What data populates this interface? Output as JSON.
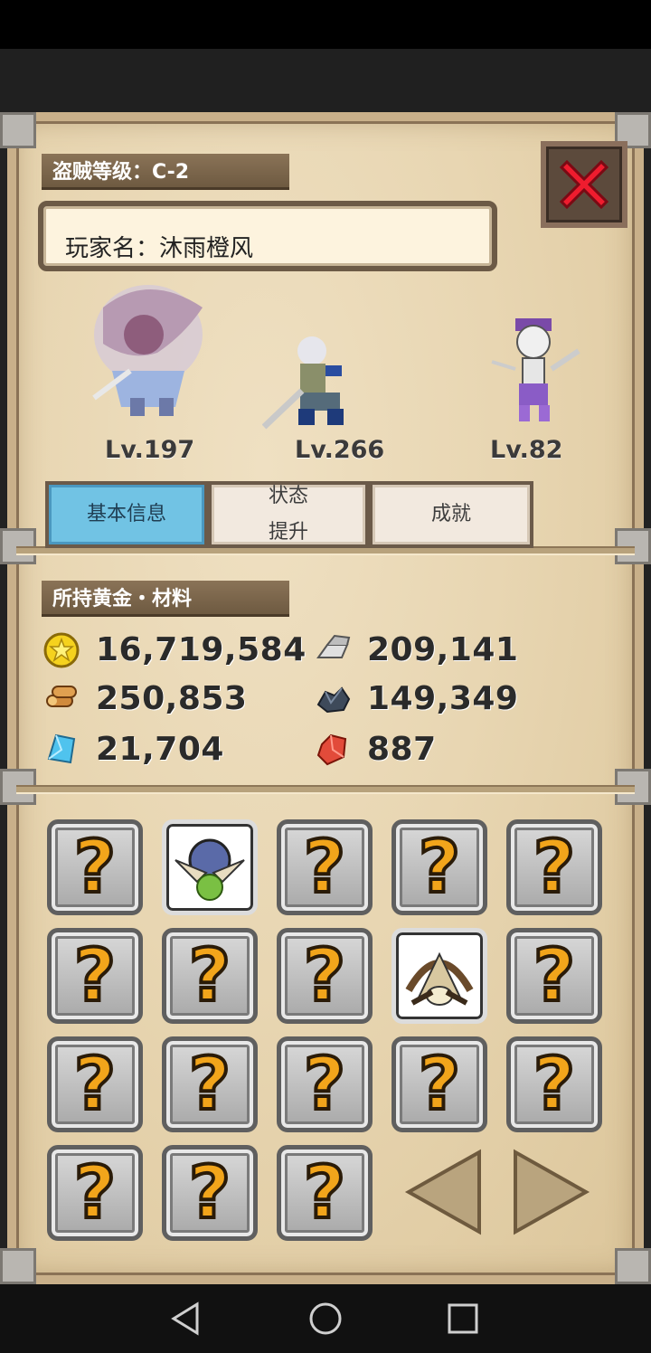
{
  "header": {
    "thief_level_label": "盗贼等级：C-2",
    "player_name_label": "玩家名：沐雨橙风"
  },
  "characters": [
    {
      "name": "werewolf",
      "level": "Lv.197"
    },
    {
      "name": "swordsman",
      "level": "Lv.266"
    },
    {
      "name": "skeleton",
      "level": "Lv.82"
    }
  ],
  "tabs": [
    {
      "label": "基本信息",
      "active": true
    },
    {
      "label": "状态\n提升",
      "line1": "状态",
      "line2": "提升",
      "active": false
    },
    {
      "label": "成就",
      "active": false
    }
  ],
  "resources": {
    "section_title": "所持黄金・材料",
    "gold": "16,719,584",
    "wood": "250,853",
    "crystal": "21,704",
    "iron": "209,141",
    "ore": "149,349",
    "gem": "887"
  },
  "slots": {
    "unknown_symbol": "?",
    "owned": [
      "emblem-skull-wings",
      "emblem-bone-crossbow"
    ]
  },
  "colors": {
    "tab_active": "#71c3e4",
    "question_mark": "#f2a51b",
    "close_x": "#ee1c2e"
  }
}
